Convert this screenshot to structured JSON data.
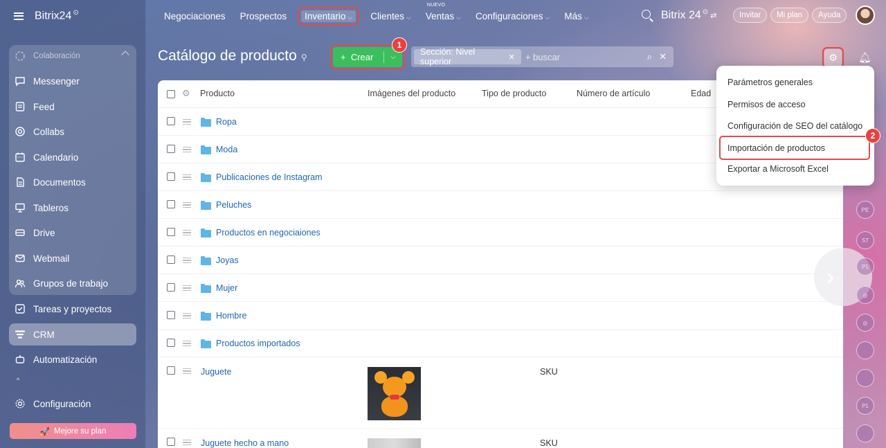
{
  "sidebar": {
    "brand": "Bitrix24",
    "brand_clock": "⊙",
    "section_header": "Colaboración",
    "items": [
      {
        "label": "Messenger",
        "icon": "chat-bubble-icon"
      },
      {
        "label": "Feed",
        "icon": "feed-icon"
      },
      {
        "label": "Collabs",
        "icon": "collabs-icon"
      },
      {
        "label": "Calendario",
        "icon": "calendar-icon"
      },
      {
        "label": "Documentos",
        "icon": "document-icon"
      },
      {
        "label": "Tableros",
        "icon": "board-icon"
      },
      {
        "label": "Drive",
        "icon": "drive-icon"
      },
      {
        "label": "Webmail",
        "icon": "mail-icon"
      },
      {
        "label": "Grupos de trabajo",
        "icon": "group-icon"
      }
    ],
    "extra_items": [
      {
        "label": "Tareas y proyectos",
        "icon": "task-icon"
      },
      {
        "label": "CRM",
        "icon": "crm-icon",
        "active": true
      },
      {
        "label": "Automatización",
        "icon": "robot-icon"
      }
    ],
    "settings_label": "Configuración",
    "upgrade_label": "Mejore su plan"
  },
  "topbar": {
    "menu": [
      {
        "label": "Negociaciones"
      },
      {
        "label": "Prospectos"
      },
      {
        "label": "Inventario",
        "highlight": true
      },
      {
        "label": "Clientes"
      },
      {
        "label": "Ventas",
        "tag": "NUEVO"
      },
      {
        "label": "Configuraciones"
      },
      {
        "label": "Más"
      }
    ],
    "brand": "Bitrix 24",
    "invite": "Invitar",
    "plan": "Mi plan",
    "help": "Ayuda"
  },
  "page": {
    "title": "Catálogo de producto",
    "create_label": "Crear",
    "step1": "1",
    "step2": "2",
    "filter_chip": "Sección: Nivel superior",
    "search_placeholder": "+ buscar"
  },
  "table": {
    "columns": [
      "Producto",
      "Imágenes del producto",
      "Tipo de producto",
      "Número de artículo",
      "Edad"
    ],
    "folders": [
      "Ropa",
      "Moda",
      "Publicaciones de Instagram",
      "Peluches",
      "Productos en negociaiones",
      "Joyas",
      "Mujer",
      "Hombre",
      "Productos importados"
    ],
    "products": [
      {
        "name": "Juguete",
        "type": "SKU"
      },
      {
        "name": "Juguete hecho a mano",
        "type": "SKU"
      }
    ]
  },
  "settings_menu": {
    "items": [
      "Parámetros generales",
      "Permisos de acceso",
      "Configuración de SEO del catálogo",
      "Importación de productos",
      "Exportar a Microsoft Excel"
    ]
  },
  "right_rail": [
    "PE",
    "ST",
    "P1",
    "P1"
  ],
  "colors": {
    "accent_green": "#3bbf5c",
    "highlight_red": "#e24b4b",
    "link_blue": "#2067b0",
    "folder_blue": "#5fb5e6"
  }
}
